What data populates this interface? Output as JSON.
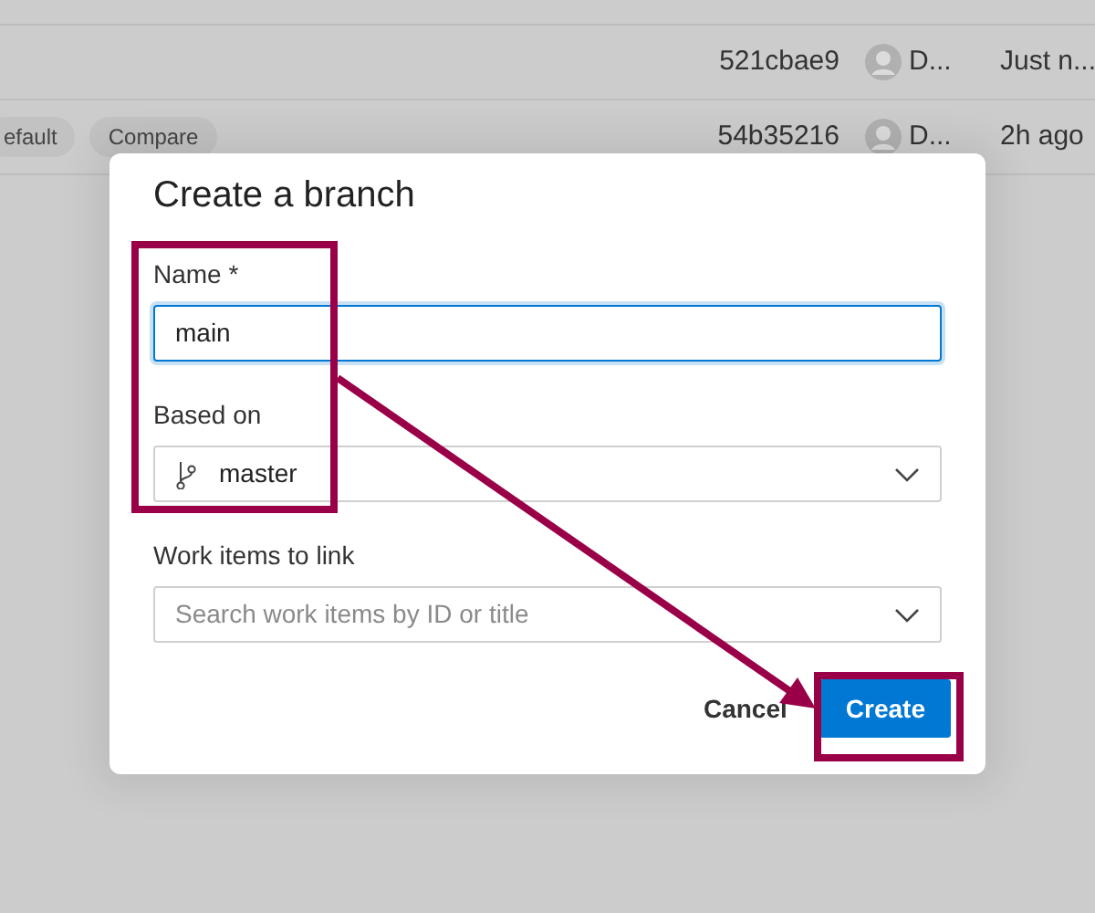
{
  "background_list": {
    "rows": [
      {
        "tags": [],
        "commit": "521cbae9",
        "author": "D...",
        "time": "Just n..."
      },
      {
        "tags": [
          "efault",
          "Compare"
        ],
        "commit": "54b35216",
        "author": "D...",
        "time": "2h ago"
      }
    ]
  },
  "dialog": {
    "title": "Create a branch",
    "fields": [
      {
        "kind": "text",
        "label": "Name *",
        "value": "main",
        "focused": true
      },
      {
        "kind": "branch",
        "label": "Based on",
        "value": "master"
      },
      {
        "kind": "search",
        "label": "Work items to link",
        "placeholder": "Search work items by ID or title"
      }
    ],
    "buttons": [
      {
        "label": "Cancel",
        "primary": false
      },
      {
        "label": "Create",
        "primary": true
      }
    ]
  },
  "callouts": [
    {
      "kind": "box"
    },
    {
      "kind": "box"
    },
    {
      "kind": "arrow"
    }
  ]
}
